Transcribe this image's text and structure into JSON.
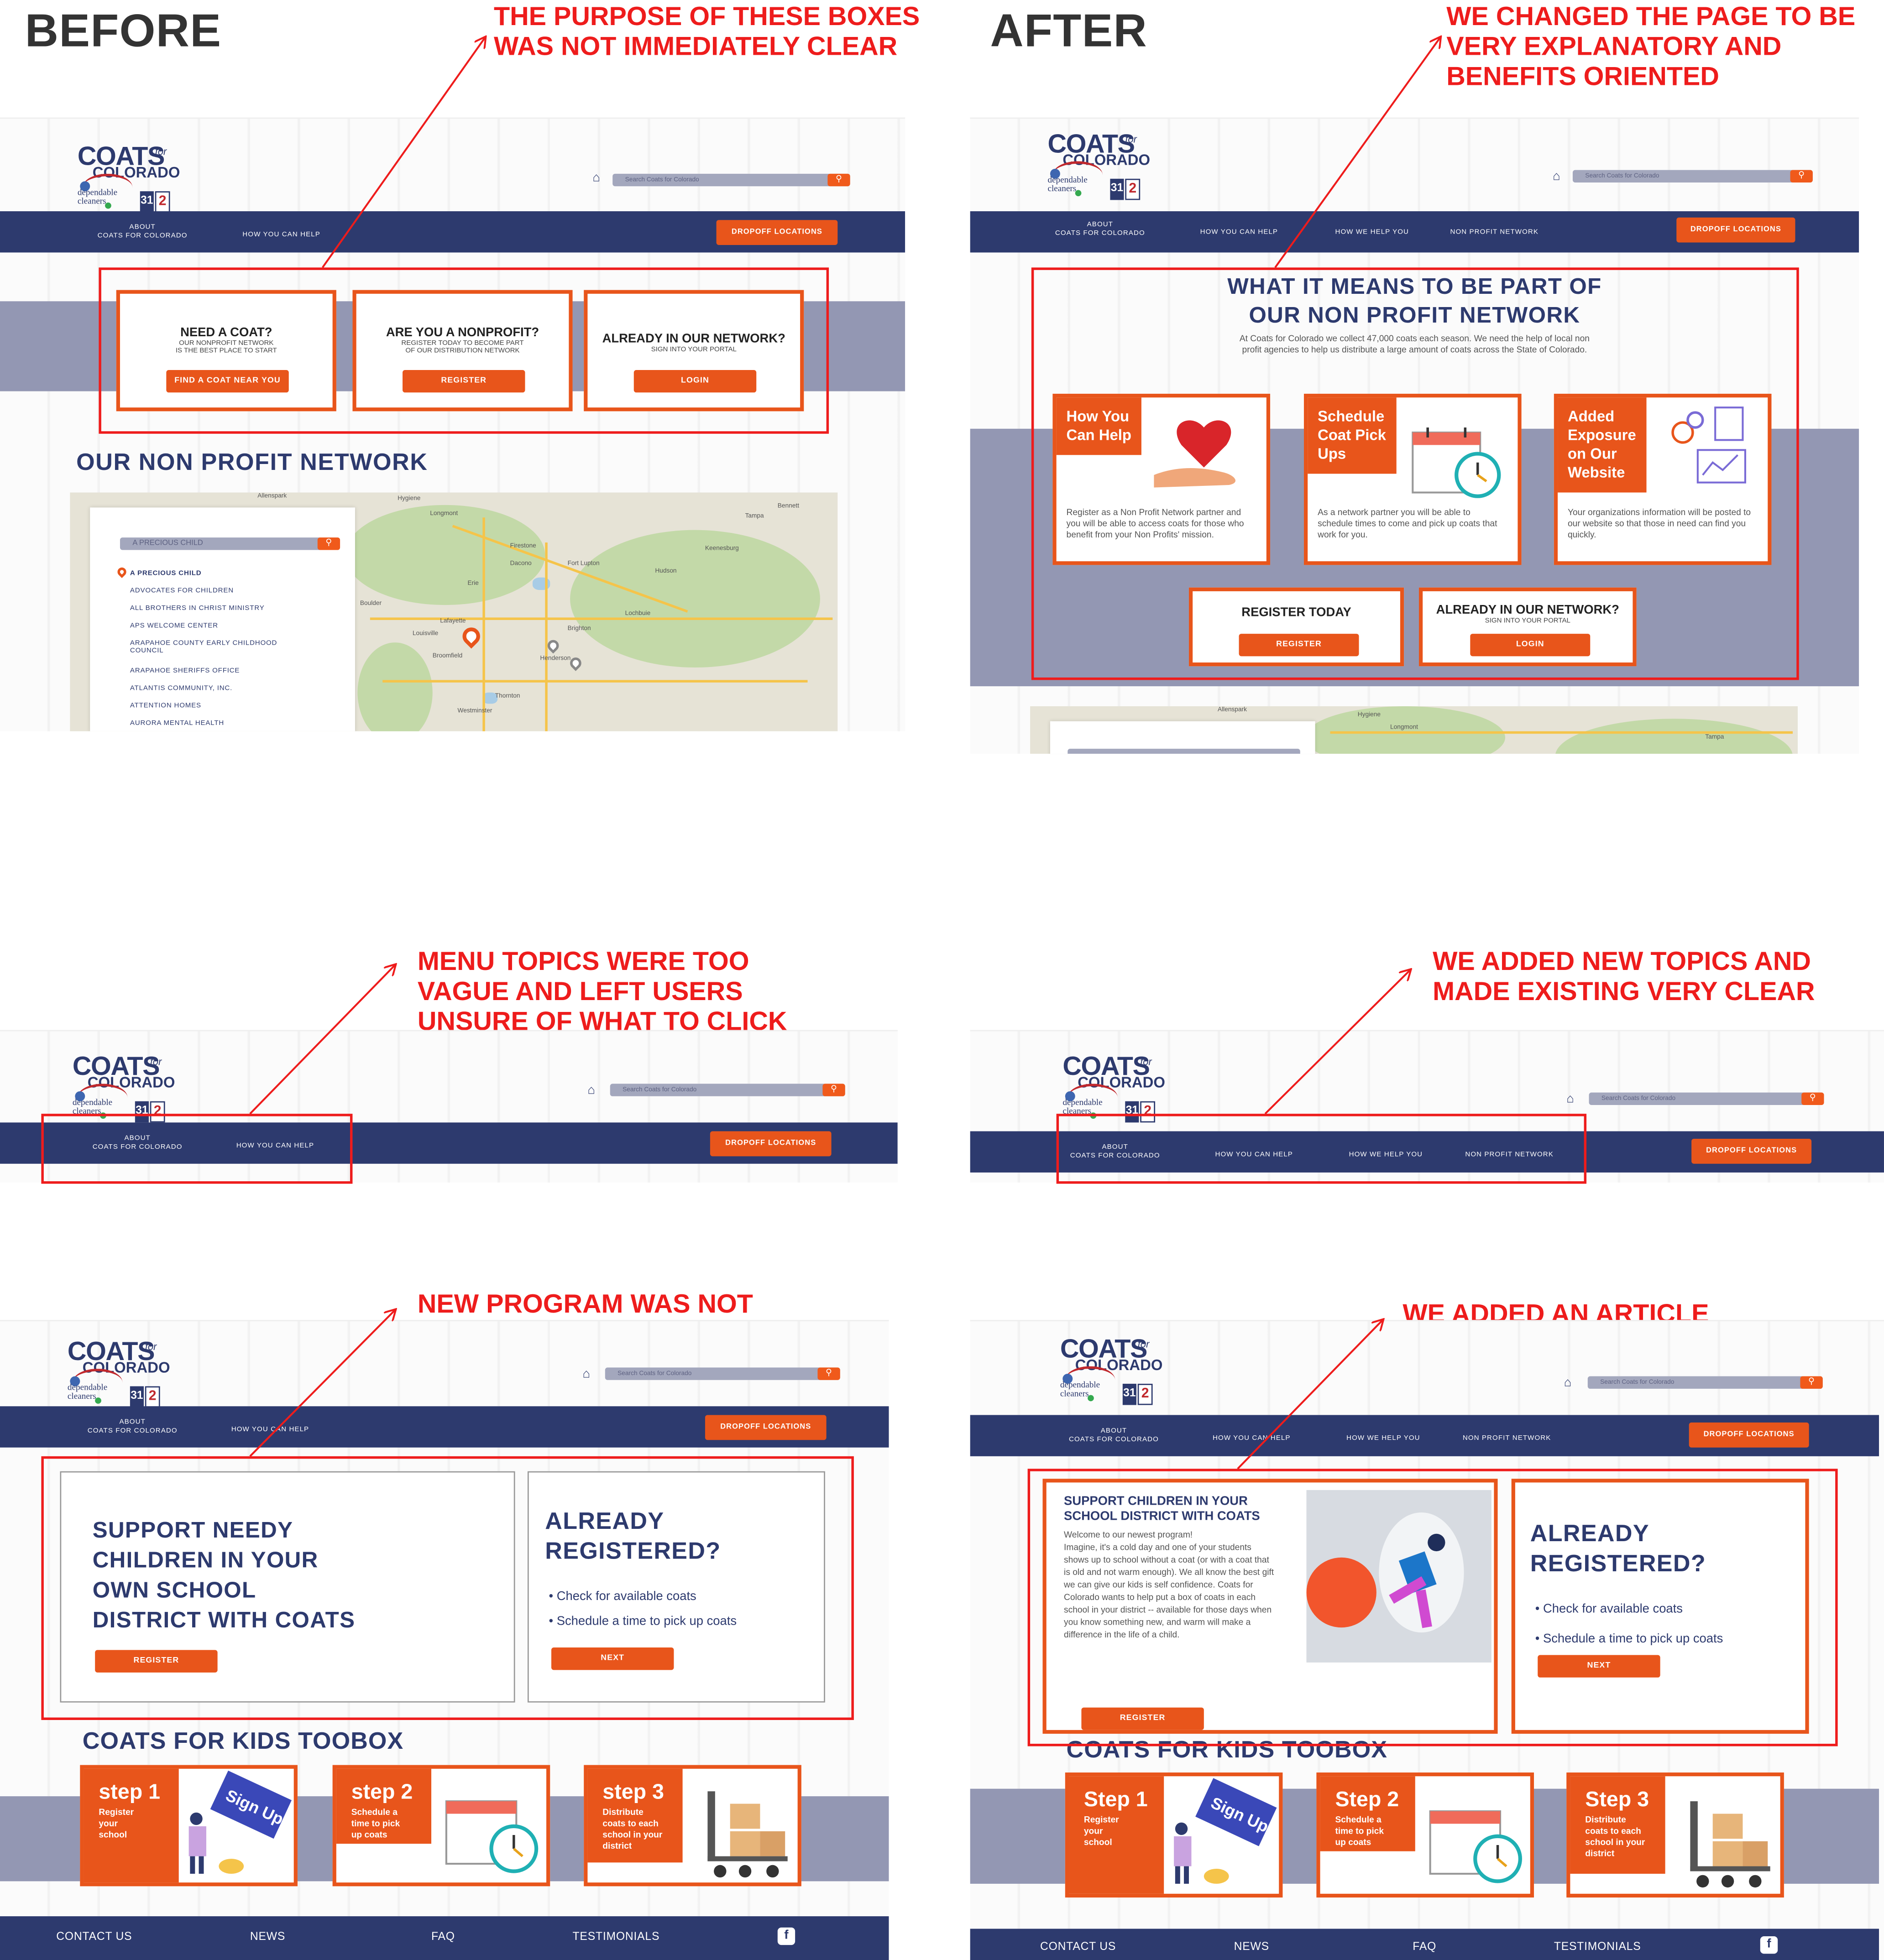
{
  "headers": {
    "before": "BEFORE",
    "after": "AFTER"
  },
  "notes": {
    "before1": "THE PURPOSE OF THESE BOXES\nWAS NOT IMMEDIATELY CLEAR",
    "after1": "WE CHANGED THE PAGE TO BE\nVERY EXPLANATORY AND\nBENEFITS ORIENTED",
    "before2": "MENU TOPICS WERE TOO\nVAGUE AND LEFT USERS\nUNSURE OF WHAT TO CLICK",
    "after2": "WE ADDED NEW TOPICS AND\nMADE EXISTING VERY CLEAR",
    "before3": "NEW PROGRAM WAS NOT\nEXPLAINED VERY WELL",
    "after3": "WE ADDED AN ARTICLE\nEXPLAINING THE BENEFITS"
  },
  "site": {
    "logo_main": "COATS",
    "logo_for": "for",
    "logo_sub": "COLORADO",
    "logo_sponsor": "dependable\ncleaners",
    "logo_tv1": "31",
    "logo_tv2": "2",
    "search_placeholder": "Search Coats for Colorado",
    "home_icon": "⌂",
    "search_icon": "⚲",
    "nav_before": [
      "ABOUT\nCOATS FOR COLORADO",
      "HOW YOU CAN HELP"
    ],
    "nav_after": [
      "ABOUT\nCOATS FOR COLORADO",
      "HOW YOU CAN HELP",
      "HOW WE HELP YOU",
      "NON PROFIT NETWORK"
    ],
    "dropoff": "DROPOFF LOCATIONS"
  },
  "before_boxes": [
    {
      "title": "NEED A COAT?",
      "sub": "OUR NONPROFIT NETWORK\nIS THE BEST PLACE TO START",
      "button": "FIND A COAT NEAR YOU"
    },
    {
      "title": "ARE YOU A NONPROFIT?",
      "sub": "REGISTER TODAY TO BECOME PART\nOF OUR DISTRIBUTION NETWORK",
      "button": "REGISTER"
    },
    {
      "title": "ALREADY IN OUR NETWORK?",
      "sub": "SIGN INTO YOUR PORTAL",
      "button": "LOGIN"
    }
  ],
  "network_heading": "OUR NON PROFIT NETWORK",
  "map": {
    "search_value": "A PRECIOUS CHILD",
    "items": [
      "A PRECIOUS CHILD",
      "ADVOCATES FOR CHILDREN",
      "ALL BROTHERS IN CHRIST MINISTRY",
      "APS WELCOME CENTER",
      "ARAPAHOE COUNTY EARLY CHILDHOOD\nCOUNCIL",
      "ARAPAHOE SHERIFFS OFFICE",
      "ATLANTIS COMMUNITY, INC.",
      "ATTENTION HOMES",
      "AURORA MENTAL HEALTH"
    ],
    "places": [
      "Allenspark",
      "Hygiene",
      "Longmont",
      "Firestone",
      "Dacono",
      "Fort Lupton",
      "Hudson",
      "Keenesburg",
      "Erie",
      "Lochbuie",
      "Brighton",
      "Lafayette",
      "Louisville",
      "Broomfield",
      "Henderson",
      "Boulder",
      "Thornton",
      "Westminster",
      "Tampa",
      "Bennett"
    ]
  },
  "after_top": {
    "heading": "WHAT IT MEANS TO BE PART OF\nOUR NON PROFIT NETWORK",
    "intro": "At Coats for Colorado we collect 47,000 coats each season. We need the help of local non\nprofit agencies to help us distribute a large amount of coats across the State of Colorado.",
    "features": [
      {
        "tag": "How You\nCan Help",
        "body": "Register as a Non Profit Network partner and you will be able to access coats for those who benefit from your Non Profits' mission."
      },
      {
        "tag": "Schedule\nCoat Pick\nUps",
        "body": "As a network partner you will be able to schedule times to come and pick up coats that work for you."
      },
      {
        "tag": "Added\nExposure\non Our\nWebsite",
        "body": "Your organizations information will be posted to our website so that those in need can find you quickly."
      }
    ],
    "register_title": "REGISTER TODAY",
    "register_button": "REGISTER",
    "network_title": "ALREADY IN OUR NETWORK?",
    "network_sub": "SIGN INTO YOUR PORTAL",
    "login_button": "LOGIN"
  },
  "before_program": {
    "support": "SUPPORT NEEDY\nCHILDREN IN YOUR\nOWN SCHOOL\nDISTRICT WITH COATS",
    "register": "REGISTER",
    "already": "ALREADY\nREGISTERED?",
    "bullets": [
      "Check for available coats",
      "Schedule a time to pick up coats"
    ],
    "next": "NEXT"
  },
  "after_program": {
    "article_title": "SUPPORT CHILDREN IN YOUR\nSCHOOL DISTRICT WITH COATS",
    "article_body": "Welcome to our newest program!\nImagine, it's a cold day and one of your students shows up to school without a coat (or with a coat that is old and not warm enough). We all know the best gift we can give our kids is self confidence. Coats for Colorado wants to help put a box of coats in each school in your district -- available for those days when you know something new, and warm will make a difference in the life of a child.",
    "register": "REGISTER",
    "already": "ALREADY\nREGISTERED?",
    "bullets": [
      "Check for available coats",
      "Schedule a time to pick up coats"
    ],
    "next": "NEXT"
  },
  "toolbox": {
    "heading": "COATS FOR KIDS TOOBOX",
    "steps_before": [
      {
        "title": "step 1",
        "desc": "Register\nyour\nschool"
      },
      {
        "title": "step 2",
        "desc": "Schedule a\ntime to pick\nup coats"
      },
      {
        "title": "step 3",
        "desc": "Distribute\ncoats to each\nschool in your\ndistrict"
      }
    ],
    "steps_after": [
      {
        "title": "Step 1",
        "desc": "Register\nyour\nschool"
      },
      {
        "title": "Step 2",
        "desc": "Schedule a\ntime to pick\nup coats"
      },
      {
        "title": "Step 3",
        "desc": "Distribute\ncoats to each\nschool in your\ndistrict"
      }
    ],
    "sign_up": "Sign Up"
  },
  "footer": {
    "links": [
      "CONTACT US",
      "NEWS",
      "FAQ",
      "TESTIMONIALS"
    ],
    "facebook": "f"
  },
  "colors": {
    "navy": "#2d3a6e",
    "orange": "#e8551b",
    "red_note": "#ee1c1c",
    "band": "#9397b3"
  }
}
